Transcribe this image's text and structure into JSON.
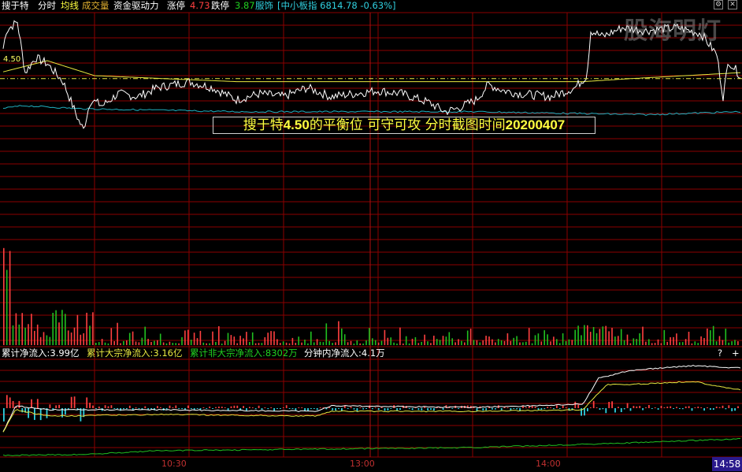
{
  "header": {
    "stock_name": "搜于特",
    "tab_intraday": "分时",
    "tab_avg": "均线",
    "tab_volume": "成交量",
    "tab_fund": "资金驱动力",
    "limit_up_label": "涨停",
    "limit_up_value": "4.73",
    "limit_down_label": "跌停",
    "limit_down_value": "3.87",
    "sector": "服饰",
    "index_text": "[中小板指 6814.78 -0.63%]"
  },
  "annotation": {
    "prefix": "搜于特",
    "price": "4.50",
    "middle": "的平衡位  可守可攻  分时截图时间",
    "date": "20200407"
  },
  "watermark": "股海明灯",
  "price_level_label": "4.50",
  "lower": {
    "cum_net": "累计净流入:3.99亿",
    "cum_large": "累计大宗净流入:3.16亿",
    "cum_nonlarge": "累计非大宗净流入:8302万",
    "minute_net": "分钟内净流入:4.1万",
    "help_icon": "?",
    "plus_icon": "+"
  },
  "time_axis": [
    "10:30",
    "13:00",
    "14:00"
  ],
  "current_time": "14:58",
  "colors": {
    "price_line": "#ffffff",
    "avg_line": "#e8e840",
    "index_line": "#20b0c0",
    "grid": "#8b0000",
    "up": "#ff4040",
    "down": "#20c020",
    "fund_large": "#e8e840",
    "fund_nonlarge": "#20c020",
    "cyan": "#30d0e0"
  },
  "chart_data": [
    {
      "type": "line",
      "panel": "intraday price",
      "balance_level": 4.5,
      "price_keypoints": [
        [
          0,
          4.54
        ],
        [
          8,
          4.66
        ],
        [
          22,
          4.69
        ],
        [
          32,
          4.52
        ],
        [
          45,
          4.57
        ],
        [
          60,
          4.55
        ],
        [
          80,
          4.49
        ],
        [
          100,
          4.36
        ],
        [
          106,
          4.33
        ],
        [
          115,
          4.43
        ],
        [
          130,
          4.41
        ],
        [
          150,
          4.45
        ],
        [
          175,
          4.44
        ],
        [
          200,
          4.47
        ],
        [
          240,
          4.49
        ],
        [
          270,
          4.47
        ],
        [
          300,
          4.43
        ],
        [
          330,
          4.45
        ],
        [
          360,
          4.44
        ],
        [
          390,
          4.47
        ],
        [
          420,
          4.44
        ],
        [
          450,
          4.45
        ],
        [
          480,
          4.46
        ],
        [
          510,
          4.45
        ],
        [
          545,
          4.42
        ],
        [
          565,
          4.39
        ],
        [
          580,
          4.4
        ],
        [
          605,
          4.43
        ],
        [
          620,
          4.48
        ],
        [
          640,
          4.46
        ],
        [
          660,
          4.45
        ],
        [
          700,
          4.44
        ],
        [
          730,
          4.47
        ],
        [
          745,
          4.51
        ],
        [
          750,
          4.66
        ],
        [
          765,
          4.64
        ],
        [
          790,
          4.67
        ],
        [
          820,
          4.66
        ],
        [
          860,
          4.67
        ],
        [
          890,
          4.65
        ],
        [
          910,
          4.58
        ],
        [
          918,
          4.44
        ],
        [
          925,
          4.56
        ],
        [
          940,
          4.51
        ]
      ],
      "avg_keypoints": [
        [
          0,
          4.52
        ],
        [
          60,
          4.56
        ],
        [
          120,
          4.51
        ],
        [
          300,
          4.49
        ],
        [
          600,
          4.49
        ],
        [
          740,
          4.49
        ],
        [
          800,
          4.5
        ],
        [
          940,
          4.52
        ]
      ],
      "index_keypoints": [
        [
          0,
          4.4
        ],
        [
          30,
          4.41
        ],
        [
          100,
          4.4
        ],
        [
          300,
          4.39
        ],
        [
          600,
          4.39
        ],
        [
          820,
          4.38
        ],
        [
          940,
          4.39
        ]
      ]
    },
    {
      "type": "bar",
      "panel": "volume",
      "bar_count": 240
    },
    {
      "type": "line",
      "panel": "fund flow",
      "series_keys": [
        "cum_net",
        "cum_large",
        "cum_nonlarge"
      ]
    }
  ]
}
